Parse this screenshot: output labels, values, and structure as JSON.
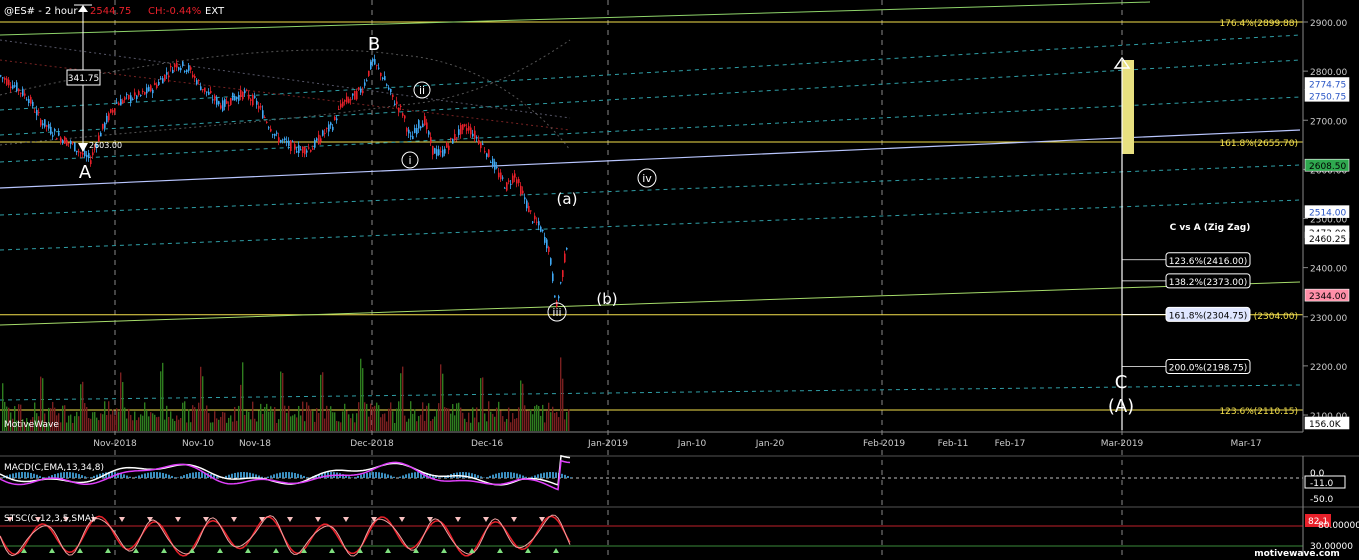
{
  "header": {
    "symbol": "@ES# - 2 hour",
    "last": "2544.75",
    "change": "CH:-0.44%",
    "session": "EXT"
  },
  "watermark": "MotiveWave",
  "site": "motivewave.com",
  "colors": {
    "bull": "#3fa9f5",
    "bear": "#e8202a",
    "fib": "#f4e04d",
    "channel_dash": "#2f9ea6",
    "trend": "#b9c6ff",
    "green_line": "#a6dc6a",
    "macd": "#ffffff",
    "signal": "#e040fb",
    "red_level": "#c0202a"
  },
  "price_axis": {
    "ticks": [
      "2900.00",
      "2800.00",
      "2700.00",
      "2600.00",
      "2500.00",
      "2400.00",
      "2300.00",
      "2200.00",
      "2100.00"
    ],
    "labels": [
      {
        "text": "2774.75",
        "style": "blue"
      },
      {
        "text": "2750.75",
        "style": "blue"
      },
      {
        "text": "2608.50",
        "style": "green"
      },
      {
        "text": "2514.00",
        "style": "blue"
      },
      {
        "text": "2473.00",
        "style": "white"
      },
      {
        "text": "2460.25",
        "style": "white"
      },
      {
        "text": "2344.00",
        "style": "red"
      },
      {
        "text": "156.0K",
        "style": "white"
      }
    ]
  },
  "time_axis": [
    "Nov-2018",
    "Nov-10",
    "Nov-18",
    "Dec-2018",
    "Dec-16",
    "Jan-2019",
    "Jan-10",
    "Jan-20",
    "Feb-2019",
    "Feb-11",
    "Feb-17",
    "Mar-2019",
    "Mar-17"
  ],
  "fib_levels": [
    {
      "text": "176.4%(2899.88)",
      "price": 2899.88
    },
    {
      "text": "161.8%(2655.70)",
      "price": 2655.7
    },
    {
      "text": "(2304.00)",
      "price": 2304.0
    },
    {
      "text": "123.6%(2110.15)",
      "price": 2110.15
    }
  ],
  "wave_labels": {
    "A": "A",
    "B": "B",
    "i": "i",
    "ii": "ii",
    "iii": "iii",
    "iv": "iv",
    "a": "(a)",
    "b": "(b)",
    "C": "C",
    "bigA": "(A)"
  },
  "annotations": {
    "range_box": "341.75",
    "low_label": "2603.00"
  },
  "cva": {
    "title": "C vs A (Zig Zag)",
    "levels": [
      {
        "text": "123.6%(2416.00)",
        "price": 2416.0
      },
      {
        "text": "138.2%(2373.00)",
        "price": 2373.0
      },
      {
        "text": "161.8%(2304.75)",
        "price": 2304.75,
        "highlight": true
      },
      {
        "text": "200.0%(2198.75)",
        "price": 2198.75
      }
    ]
  },
  "macd": {
    "label": "MACD(C,EMA,13,34,8)",
    "ticks": [
      "0.0",
      "-50.0"
    ],
    "value": "-11.0"
  },
  "stoch": {
    "label": "STSC(C,12,3,5,SMA)",
    "ticks": [
      "80.00000",
      "30.00000"
    ],
    "value": "82.1"
  },
  "chart_data": {
    "type": "candlestick",
    "symbol": "@ES#",
    "timeframe": "2 hour",
    "price_range": [
      2080,
      2960
    ],
    "points": [
      [
        0,
        2790
      ],
      [
        14,
        2770
      ],
      [
        28,
        2745
      ],
      [
        40,
        2700
      ],
      [
        50,
        2680
      ],
      [
        60,
        2665
      ],
      [
        72,
        2650
      ],
      [
        82,
        2630
      ],
      [
        90,
        2620
      ],
      [
        98,
        2665
      ],
      [
        106,
        2700
      ],
      [
        116,
        2735
      ],
      [
        128,
        2745
      ],
      [
        140,
        2750
      ],
      [
        152,
        2765
      ],
      [
        164,
        2790
      ],
      [
        176,
        2815
      ],
      [
        188,
        2805
      ],
      [
        200,
        2770
      ],
      [
        212,
        2745
      ],
      [
        222,
        2730
      ],
      [
        232,
        2745
      ],
      [
        244,
        2755
      ],
      [
        256,
        2735
      ],
      [
        266,
        2700
      ],
      [
        276,
        2665
      ],
      [
        288,
        2650
      ],
      [
        300,
        2640
      ],
      [
        312,
        2645
      ],
      [
        322,
        2670
      ],
      [
        332,
        2690
      ],
      [
        342,
        2735
      ],
      [
        352,
        2745
      ],
      [
        362,
        2765
      ],
      [
        372,
        2820
      ],
      [
        382,
        2790
      ],
      [
        392,
        2745
      ],
      [
        402,
        2715
      ],
      [
        410,
        2660
      ],
      [
        418,
        2690
      ],
      [
        424,
        2700
      ],
      [
        432,
        2640
      ],
      [
        440,
        2630
      ],
      [
        450,
        2655
      ],
      [
        460,
        2680
      ],
      [
        468,
        2685
      ],
      [
        478,
        2660
      ],
      [
        488,
        2630
      ],
      [
        498,
        2590
      ],
      [
        506,
        2565
      ],
      [
        514,
        2590
      ],
      [
        522,
        2550
      ],
      [
        532,
        2500
      ],
      [
        540,
        2480
      ],
      [
        548,
        2440
      ],
      [
        556,
        2320
      ],
      [
        562,
        2390
      ],
      [
        568,
        2475
      ]
    ],
    "annotated": {
      "A_low": 2603.0,
      "B_high": 2815.0,
      "iii_low": 2316.75,
      "range_A_to_B": 341.75
    },
    "target_box": [
      2608.5,
      2800.0
    ]
  }
}
